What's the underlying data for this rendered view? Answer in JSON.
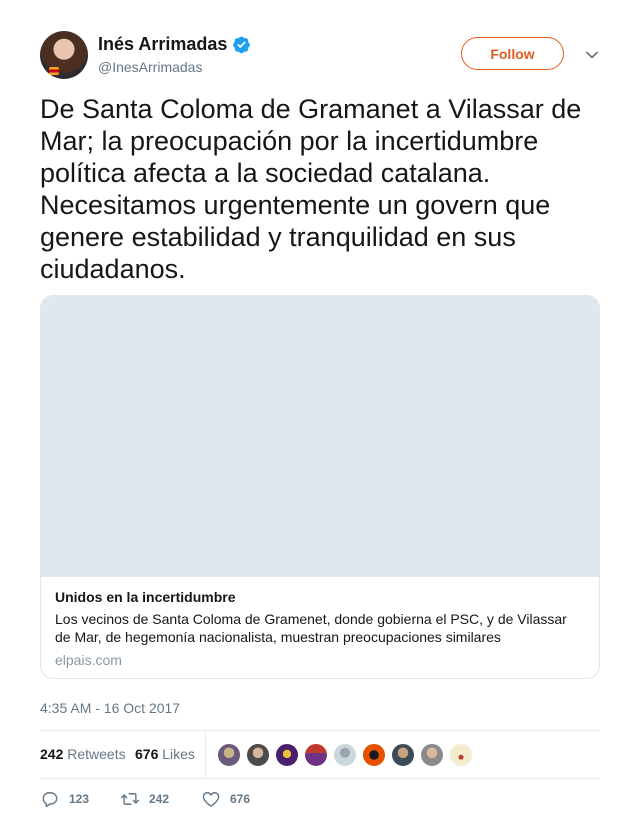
{
  "author": {
    "name": "Inés Arrimadas",
    "handle": "@InesArrimadas",
    "verified": true
  },
  "follow_button": {
    "label": "Follow"
  },
  "tweet": {
    "text": "De Santa Coloma de Gramanet a Vilassar de Mar; la preocupación por la incertidumbre política afecta a la sociedad catalana. Necesitamos urgentemente un govern que genere estabilidad y tranquilidad en sus ciudadanos.",
    "timestamp": "4:35 AM - 16 Oct 2017"
  },
  "card": {
    "title": "Unidos en la incertidumbre",
    "description": "Los vecinos de Santa Coloma de Gramenet, donde gobierna el PSC, y de Vilassar de Mar, de hegemonía nacionalista, muestran preocupaciones similares",
    "domain": "elpais.com"
  },
  "stats": {
    "retweets_count": "242",
    "retweets_label": "Retweets",
    "likes_count": "676",
    "likes_label": "Likes"
  },
  "actions": {
    "reply_count": "123",
    "retweet_count": "242",
    "like_count": "676"
  },
  "colors": {
    "accent": "#e35d1f",
    "verified": "#1da1f2",
    "secondary_text": "#657786",
    "card_placeholder": "#e1e8ed"
  }
}
